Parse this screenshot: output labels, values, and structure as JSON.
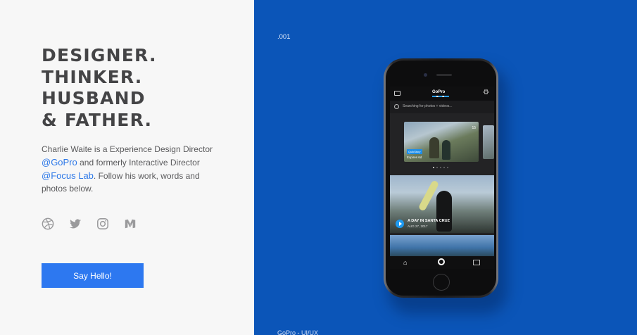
{
  "intro": {
    "headline_lines": [
      "DESIGNER.",
      "THINKER.",
      "HUSBAND",
      "& FATHER."
    ],
    "bio": {
      "part1": "Charlie Waite is a Experience Design Director ",
      "link_gopro": "@GoPro",
      "part2": " and formerly Interactive Director ",
      "link_focuslab": "@Focus Lab",
      "part3": ". Follow his work, words and photos below."
    },
    "socials": [
      "dribbble-icon",
      "twitter-icon",
      "instagram-icon",
      "medium-icon"
    ],
    "cta_label": "Say Hello!"
  },
  "project": {
    "number": ".001",
    "caption": "GoPro - UI/UX",
    "accent_color": "#0b55b8",
    "app": {
      "logo_text": "GoPro",
      "search_text": "Searching for photos + videos...",
      "card_tag": "QuikStory",
      "card_expiry": "Expires 6d",
      "card_date": "15",
      "feature_title": "A DAY IN SANTA CRUZ",
      "feature_date": "AUG 27, 2017"
    }
  },
  "colors": {
    "link": "#2d78e8",
    "button": "#2d78f0",
    "headline": "#444446",
    "panel_bg": "#f7f7f7"
  }
}
